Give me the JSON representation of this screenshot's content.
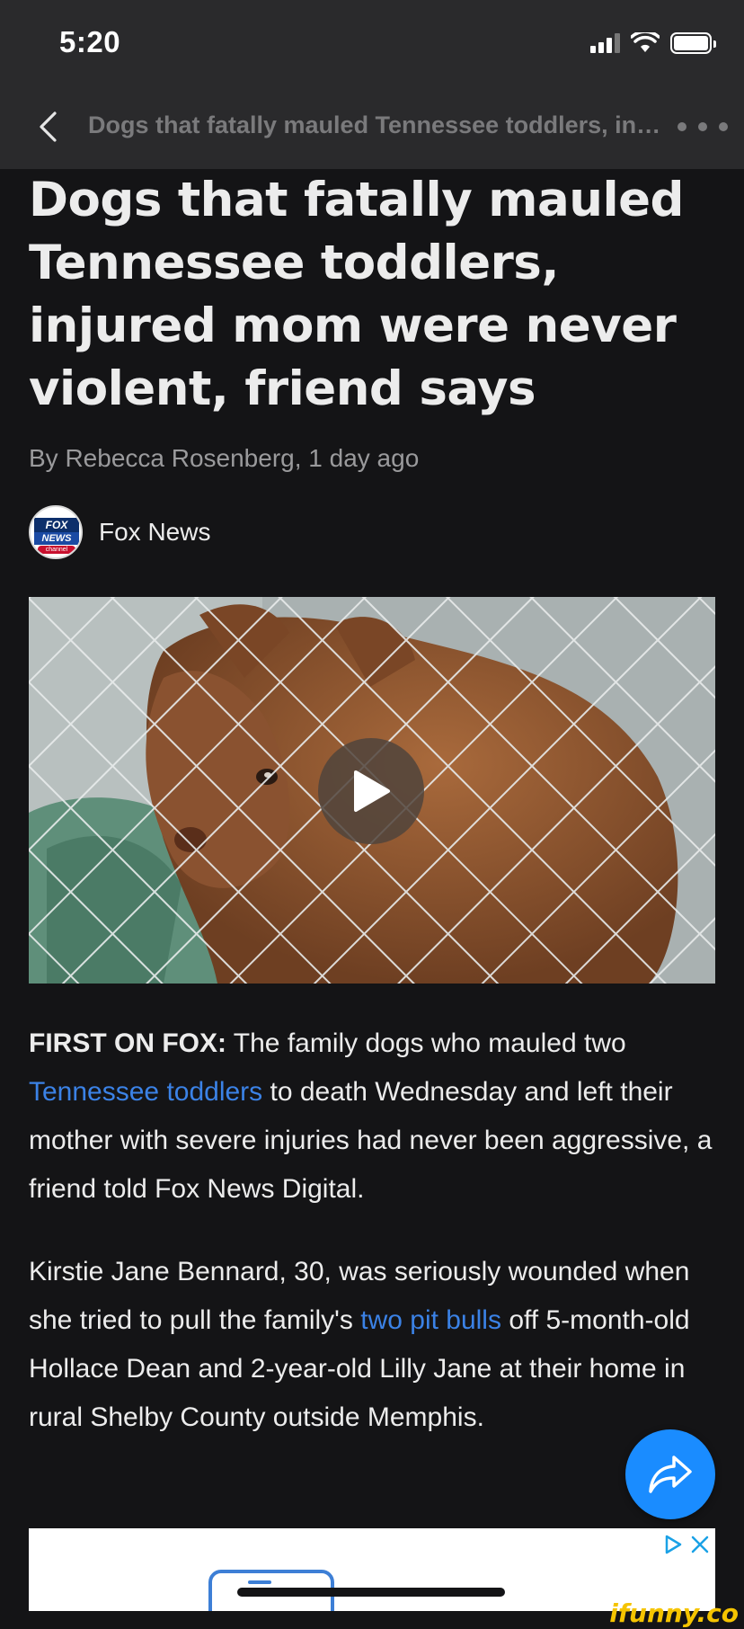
{
  "status_bar": {
    "time": "5:20"
  },
  "nav": {
    "title": "Dogs that fatally mauled Tennessee toddlers, injured mom were never violent, friend says"
  },
  "article": {
    "headline": "Dogs that fatally mauled Tennessee toddlers, injured mom were never violent, friend says",
    "byline": "By Rebecca Rosenberg, 1 day ago",
    "source": {
      "name": "Fox News",
      "logo_text": [
        "FOX",
        "NEWS",
        "channel"
      ]
    },
    "video": {
      "play_icon": "play-icon"
    },
    "paragraph1": {
      "lead": "FIRST ON FOX:",
      "text_a": " The family dogs who mauled two ",
      "link": "Tennessee toddlers",
      "text_b": " to death Wednesday and left their mother with severe injuries had never been aggressive, a friend told Fox News Digital."
    },
    "paragraph2": {
      "text_a": "Kirstie Jane Bennard, 30, was seriously wounded when she tried to pull the family's ",
      "link": "two pit bulls",
      "text_b": " off 5-month-old Hollace Dean and 2-year-old Lilly Jane at their home in rural Shelby County outside Memphis."
    }
  },
  "share_button": {
    "icon": "share-arrow-icon"
  },
  "ad": {
    "icons": [
      "adchoices-icon",
      "close-icon"
    ]
  },
  "watermark": "ifunny.co",
  "colors": {
    "background": "#141416",
    "bar": "#2a2a2c",
    "link": "#3b82e6",
    "fab": "#1a8cff"
  }
}
